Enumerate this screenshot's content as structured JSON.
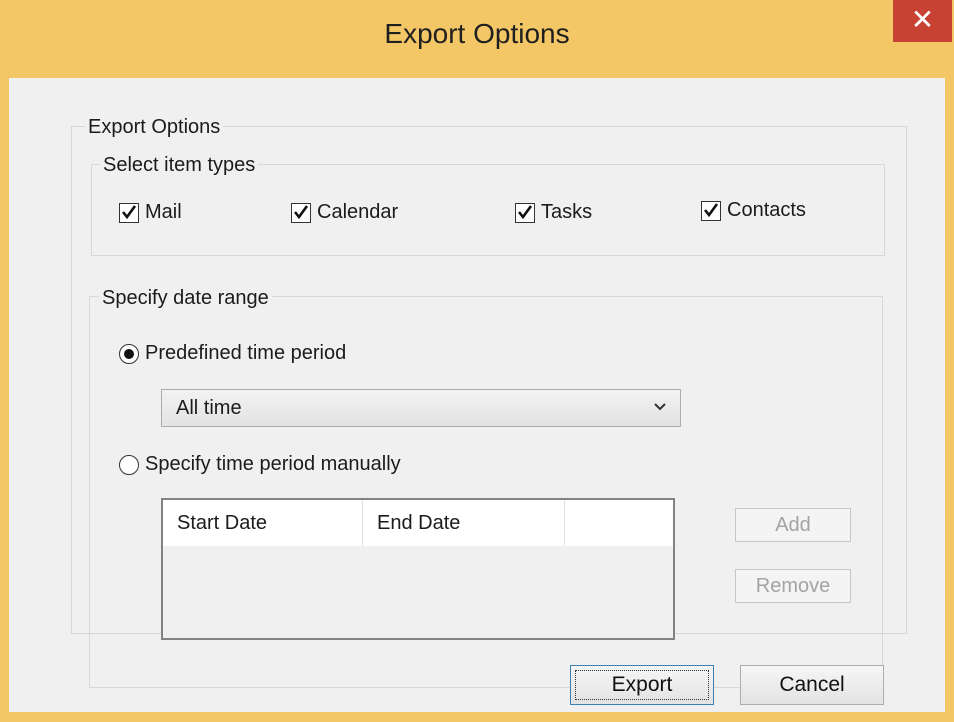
{
  "window": {
    "title": "Export Options",
    "close_glyph": "✕"
  },
  "export_group": {
    "legend": "Export Options"
  },
  "item_types": {
    "legend": "Select item types",
    "items": [
      {
        "label": "Mail",
        "checked": true
      },
      {
        "label": "Calendar",
        "checked": true
      },
      {
        "label": "Tasks",
        "checked": true
      },
      {
        "label": "Contacts",
        "checked": true
      }
    ]
  },
  "date_range": {
    "legend": "Specify date range",
    "predefined_label": "Predefined time period",
    "predefined_selected": true,
    "period_value": "All time",
    "manual_label": "Specify time period manually",
    "manual_selected": false,
    "columns": [
      "Start Date",
      "End Date",
      ""
    ],
    "add_label": "Add",
    "remove_label": "Remove"
  },
  "footer": {
    "export_label": "Export",
    "cancel_label": "Cancel"
  },
  "colors": {
    "title_bar": "#f3c765",
    "close": "#c74232",
    "dialog_bg": "#f0f0f0"
  }
}
